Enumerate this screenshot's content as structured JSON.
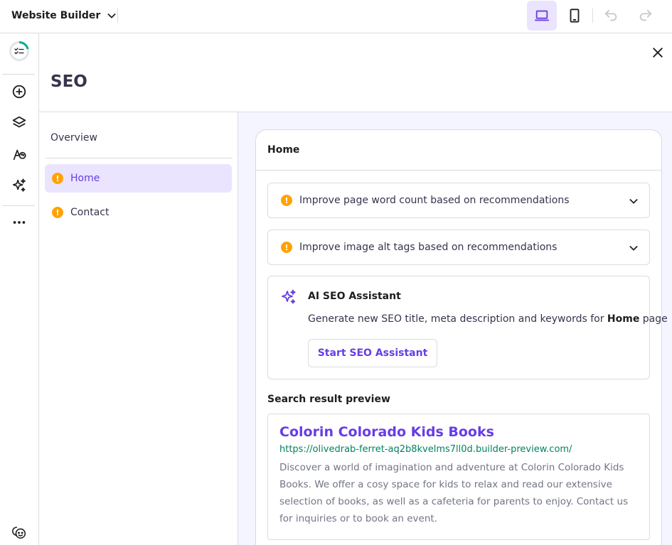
{
  "topbar": {
    "app_name": "Website Builder",
    "icons": [
      "chevron-down-icon",
      "laptop-icon",
      "mobile-icon",
      "undo-icon",
      "redo-icon"
    ]
  },
  "rail": {
    "icons": [
      "progress-checklist-icon",
      "add-circle-icon",
      "layers-icon",
      "palette-icon",
      "sparkles-icon",
      "more-icon",
      "face-icon"
    ]
  },
  "panel": {
    "title": "SEO"
  },
  "pages": {
    "overview_label": "Overview",
    "items": [
      {
        "label": "Home",
        "active": true,
        "warning": "!"
      },
      {
        "label": "Contact",
        "active": false,
        "warning": "!"
      }
    ]
  },
  "card": {
    "title": "Home",
    "recommendations": [
      {
        "warning": "!",
        "label": "Improve page word count based on recommendations"
      },
      {
        "warning": "!",
        "label": "Improve image alt tags based on recommendations"
      }
    ],
    "ai": {
      "title": "AI SEO Assistant",
      "desc_prefix": "Generate new SEO title, meta description and keywords for ",
      "desc_page": "Home",
      "desc_suffix": " page",
      "button_label": "Start SEO Assistant"
    },
    "preview": {
      "label": "Search result preview",
      "title": "Colorin Colorado Kids Books",
      "url": "https://olivedrab-ferret-aq2b8kvelms7ll0d.builder-preview.com/",
      "description": "Discover a world of imagination and adventure at Colorin Colorado Kids Books. We offer a cosy space for kids to relax and read our extensive selection of books, as well as a cafeteria for parents to enjoy. Contact us for inquiries or to book an event."
    }
  },
  "colors": {
    "accent": "#673de6",
    "accent_bg": "#ebe4ff",
    "warning": "#ffa305",
    "url_green": "#008361",
    "content_bg": "#f4f5ff"
  }
}
